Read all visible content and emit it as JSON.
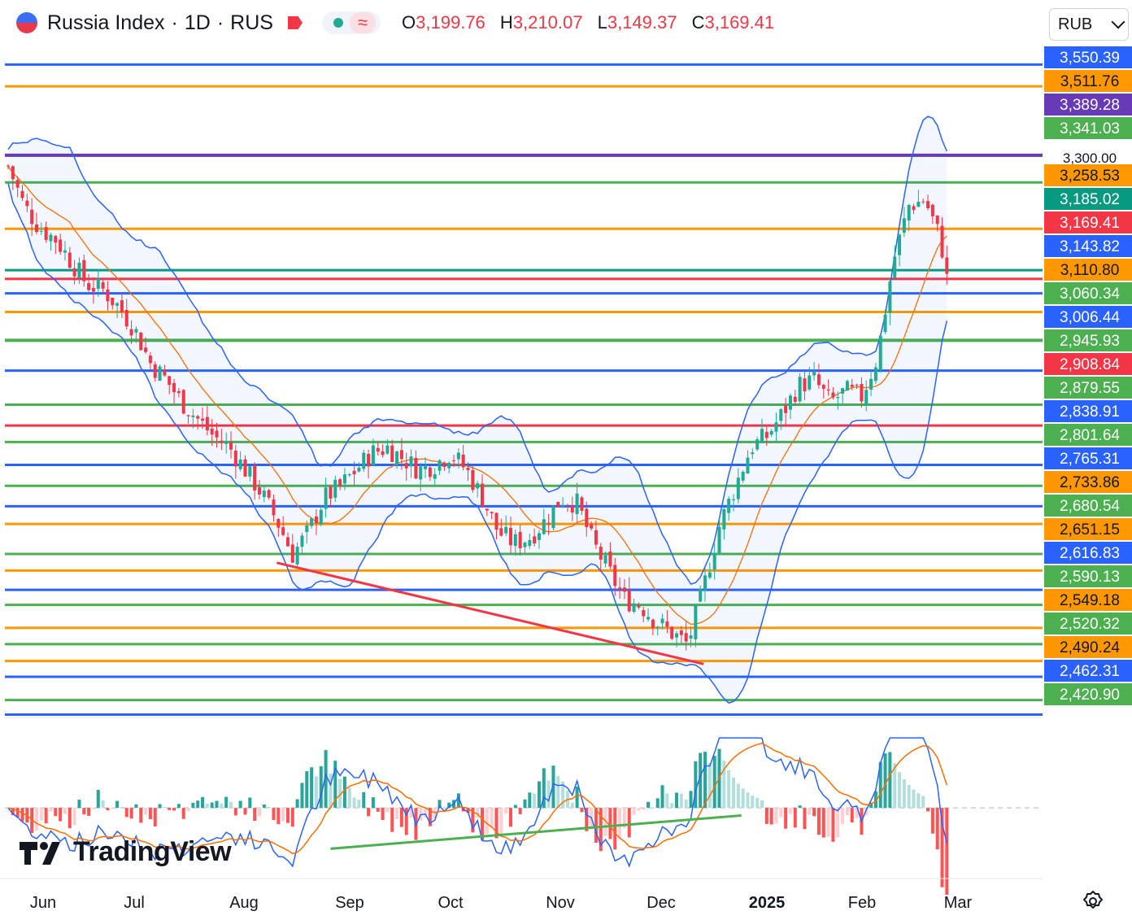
{
  "header": {
    "symbol": "Russia Index",
    "interval": "1D",
    "exchange": "RUS",
    "ohlc": {
      "o_label": "O",
      "o": "3,199.76",
      "h_label": "H",
      "h": "3,210.07",
      "l_label": "L",
      "l": "3,149.37",
      "c_label": "C",
      "c": "3,169.41"
    }
  },
  "currency": "RUB",
  "brand": "TradingView",
  "icons": [
    "flag-icon",
    "tag-icon",
    "dot-icon",
    "wave-icon",
    "chevron-down-icon",
    "gear-icon",
    "tradingview-logo-icon"
  ],
  "colors": {
    "up": "#22ab94",
    "down": "#f23645",
    "blue": "#2962ff",
    "orange": "#ff9800",
    "green": "#4caf50",
    "purple": "#673ab7",
    "red": "#f23645",
    "teal": "#089981",
    "band": "#2962ff",
    "ma": "#ff6d00"
  },
  "chart_data": [
    {
      "type": "candlestick",
      "x_ticks": [
        "Jun",
        "Jul",
        "Aug",
        "Sep",
        "Oct",
        "Nov",
        "Dec",
        "2025",
        "Feb",
        "Mar"
      ],
      "ylim": [
        2390,
        3590
      ],
      "last_price": 3169.41,
      "price_labels": [
        "3,550.39",
        "3,511.76",
        "3,389.28",
        "3,341.03",
        "3,300.00",
        "3,258.53",
        "3,185.02",
        "3,169.41",
        "3,143.82",
        "3,110.80",
        "3,060.34",
        "3,006.44",
        "2,945.93",
        "2,908.84",
        "2,879.55",
        "2,838.91",
        "2,801.64",
        "2,765.31",
        "2,733.86",
        "2,680.54",
        "2,651.15",
        "2,616.83",
        "2,590.13",
        "2,549.18",
        "2,520.32",
        "2,490.24",
        "2,462.31",
        "2,420.90"
      ],
      "levels": [
        {
          "price": 3550.39,
          "color": "#2962ff"
        },
        {
          "price": 3511.76,
          "color": "#ff9800"
        },
        {
          "price": 3389.28,
          "color": "#673ab7"
        },
        {
          "price": 3341.03,
          "color": "#4caf50"
        },
        {
          "price": 3258.53,
          "color": "#ff9800"
        },
        {
          "price": 3185.02,
          "color": "#089981"
        },
        {
          "price": 3169.41,
          "color": "#f23645"
        },
        {
          "price": 3143.82,
          "color": "#2962ff"
        },
        {
          "price": 3110.8,
          "color": "#ff9800"
        },
        {
          "price": 3060.34,
          "color": "#4caf50"
        },
        {
          "price": 3006.44,
          "color": "#2962ff"
        },
        {
          "price": 2945.93,
          "color": "#4caf50"
        },
        {
          "price": 2908.84,
          "color": "#f23645"
        },
        {
          "price": 2879.55,
          "color": "#4caf50"
        },
        {
          "price": 2838.91,
          "color": "#2962ff"
        },
        {
          "price": 2801.64,
          "color": "#4caf50"
        },
        {
          "price": 2765.31,
          "color": "#2962ff"
        },
        {
          "price": 2733.86,
          "color": "#ff9800"
        },
        {
          "price": 2680.54,
          "color": "#4caf50"
        },
        {
          "price": 2651.15,
          "color": "#ff9800"
        },
        {
          "price": 2616.83,
          "color": "#2962ff"
        },
        {
          "price": 2590.13,
          "color": "#4caf50"
        },
        {
          "price": 2549.18,
          "color": "#ff9800"
        },
        {
          "price": 2520.32,
          "color": "#4caf50"
        },
        {
          "price": 2490.24,
          "color": "#ff9800"
        },
        {
          "price": 2462.31,
          "color": "#2962ff"
        },
        {
          "price": 2420.9,
          "color": "#4caf50"
        },
        {
          "price": 2395.0,
          "color": "#2962ff"
        }
      ],
      "close_path": [
        [
          0,
          3370
        ],
        [
          5,
          3300
        ],
        [
          10,
          3260
        ],
        [
          15,
          3240
        ],
        [
          20,
          3200
        ],
        [
          25,
          3160
        ],
        [
          30,
          3150
        ],
        [
          35,
          3120
        ],
        [
          40,
          3080
        ],
        [
          45,
          3020
        ],
        [
          50,
          2990
        ],
        [
          55,
          2950
        ],
        [
          60,
          2920
        ],
        [
          65,
          2890
        ],
        [
          70,
          2870
        ],
        [
          75,
          2830
        ],
        [
          80,
          2790
        ],
        [
          85,
          2740
        ],
        [
          90,
          2680
        ],
        [
          95,
          2720
        ],
        [
          100,
          2780
        ],
        [
          105,
          2800
        ],
        [
          110,
          2830
        ],
        [
          115,
          2860
        ],
        [
          120,
          2870
        ],
        [
          125,
          2850
        ],
        [
          130,
          2830
        ],
        [
          135,
          2840
        ],
        [
          140,
          2860
        ],
        [
          145,
          2830
        ],
        [
          150,
          2780
        ],
        [
          155,
          2720
        ],
        [
          160,
          2700
        ],
        [
          165,
          2710
        ],
        [
          170,
          2740
        ],
        [
          175,
          2780
        ],
        [
          180,
          2770
        ],
        [
          185,
          2700
        ],
        [
          190,
          2650
        ],
        [
          195,
          2600
        ],
        [
          200,
          2590
        ],
        [
          205,
          2560
        ],
        [
          210,
          2540
        ],
        [
          215,
          2520
        ],
        [
          220,
          2620
        ],
        [
          225,
          2730
        ],
        [
          230,
          2800
        ],
        [
          235,
          2870
        ],
        [
          240,
          2890
        ],
        [
          245,
          2930
        ],
        [
          250,
          2980
        ],
        [
          255,
          2990
        ],
        [
          260,
          2950
        ],
        [
          265,
          2970
        ],
        [
          270,
          2960
        ],
        [
          275,
          3030
        ],
        [
          280,
          3200
        ],
        [
          285,
          3300
        ],
        [
          290,
          3310
        ],
        [
          295,
          3240
        ],
        [
          297,
          3169
        ]
      ],
      "trendline": [
        [
          85,
          2665
        ],
        [
          220,
          2485
        ]
      ]
    },
    {
      "type": "oscillator",
      "ylim": [
        -110,
        130
      ],
      "y_ticks": [
        "100.00",
        "0.00",
        "−100.00"
      ],
      "divergence_line": [
        [
          102,
          -70
        ],
        [
          232,
          -13
        ]
      ]
    }
  ]
}
